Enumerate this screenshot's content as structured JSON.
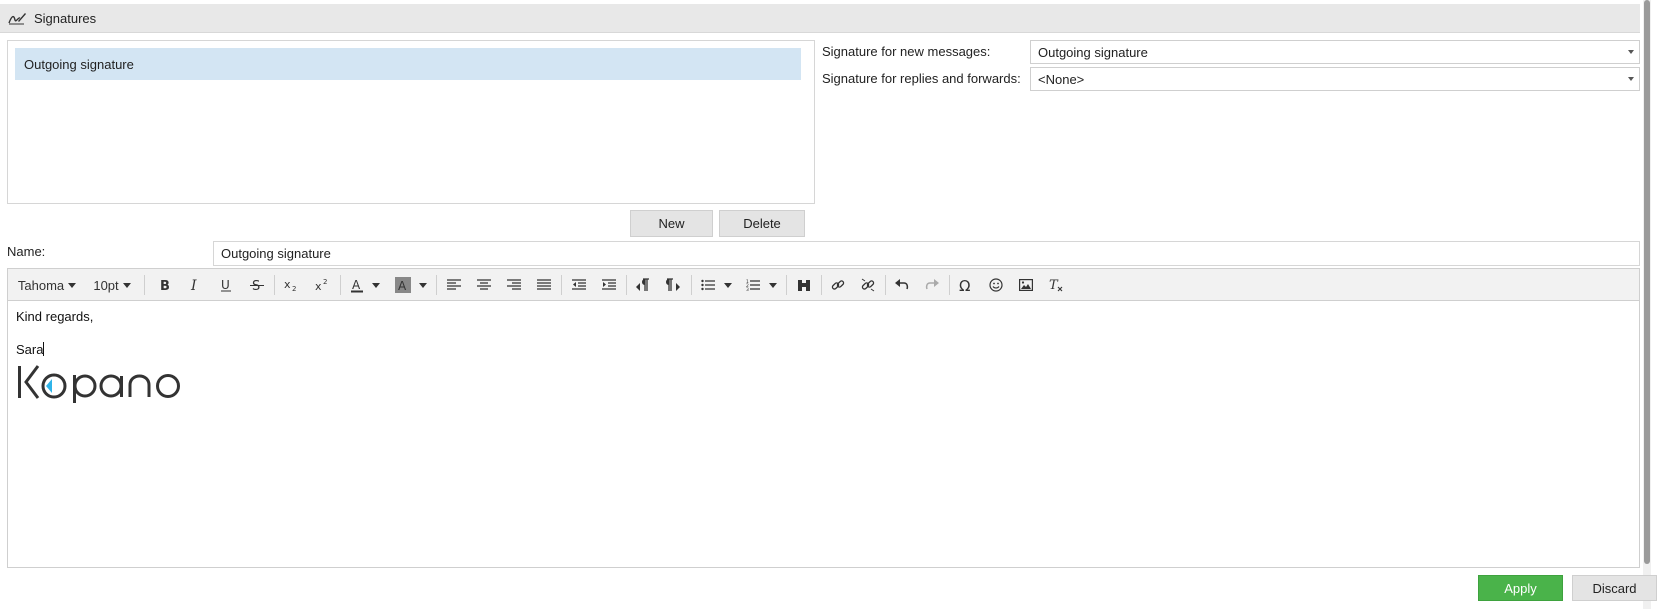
{
  "header": {
    "title": "Signatures",
    "icon": "signature-pen-icon"
  },
  "signature_list": {
    "items": [
      {
        "label": "Outgoing signature",
        "selected": true
      }
    ]
  },
  "defaults": {
    "new_messages": {
      "label": "Signature for new messages:",
      "value": "Outgoing signature"
    },
    "replies_forwards": {
      "label": "Signature for replies and forwards:",
      "value": "<None>"
    }
  },
  "buttons": {
    "new_label": "New",
    "delete_label": "Delete",
    "apply_label": "Apply",
    "discard_label": "Discard"
  },
  "name_field": {
    "label": "Name:",
    "value": "Outgoing signature"
  },
  "editor": {
    "font_family": "Tahoma",
    "font_size": "10pt",
    "toolbar_icons": [
      "bold-icon",
      "italic-icon",
      "underline-icon",
      "strikethrough-icon",
      "subscript-icon",
      "superscript-icon",
      "text-color-icon",
      "background-color-icon",
      "align-left-icon",
      "align-center-icon",
      "align-right-icon",
      "align-justify-icon",
      "outdent-icon",
      "indent-icon",
      "ltr-icon",
      "rtl-icon",
      "bullet-list-icon",
      "numbered-list-icon",
      "find-replace-icon",
      "link-icon",
      "unlink-icon",
      "undo-icon",
      "redo-icon",
      "special-char-icon",
      "emoticon-icon",
      "image-icon",
      "clear-format-icon"
    ],
    "content": {
      "line1": "Kind regards,",
      "line2": "Sara"
    },
    "logo_text": "Kopano"
  },
  "colors": {
    "apply": "#4ab34a",
    "selected_row": "#d3e5f3",
    "logo_accent": "#2fb4e9"
  }
}
